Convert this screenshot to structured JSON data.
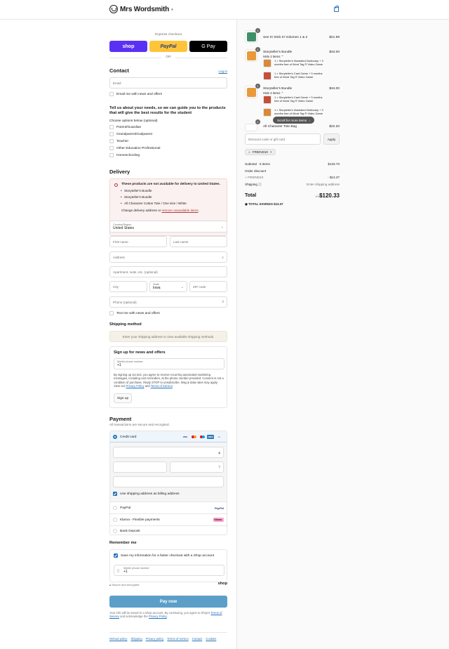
{
  "header": {
    "brand": "Mrs Wordsmith",
    "brand_suffix": "®"
  },
  "express": {
    "label": "Express checkout",
    "shop": "shop",
    "paypal": "PayPal",
    "gpay": "G Pay",
    "or": "OR"
  },
  "contact": {
    "title": "Contact",
    "login": "Log in",
    "email_placeholder": "Email",
    "email_news": "Email me with news and offers",
    "question": "Tell us about your needs, so we can guide you to the products that will give the best results for the student",
    "options_label": "Choose options below (optional)",
    "options": [
      "Parent/Guardian",
      "Grandparent/Godparent",
      "Teacher",
      "Other Education Professional",
      "Homeschooling"
    ]
  },
  "delivery": {
    "title": "Delivery",
    "alert_title": "These products are not available for delivery to United States.",
    "alert_items": [
      "Storyteller's Bundle",
      "Storyteller's Bundle",
      "All Character Cotton Tote / One size / White"
    ],
    "alert_change": "Change delivery address or",
    "alert_link": "remove unavailable items",
    "alert_end": ".",
    "country_label": "Country/Region",
    "country_value": "United States",
    "first_name": "First name",
    "last_name": "Last name",
    "address": "Address",
    "apartment": "Apartment, suite, etc. (optional)",
    "city": "City",
    "state_label": "State",
    "state_value": "Iowa",
    "zip": "ZIP code",
    "phone": "Phone (optional)",
    "text_news": "Text me with news and offers"
  },
  "shipping": {
    "title": "Shipping method",
    "notice": "Enter your shipping address to view available shipping methods."
  },
  "signup": {
    "title": "Sign up for news and offers",
    "phone_label": "Mobile phone number",
    "phone_value": "+1",
    "fine": "By signing up via text, you agree to receive recurring automated marketing messages, including cart reminders, at the phone number provided. Consent is not a condition of purchase. Reply STOP to unsubscribe. Msg & data rates may apply. View our",
    "privacy": "Privacy Policy",
    "and": "and",
    "terms": "Terms of Service",
    "end": ".",
    "button": "Sign up"
  },
  "payment": {
    "title": "Payment",
    "subtitle": "All transactions are secure and encrypted.",
    "credit_card": "Credit card",
    "card_brands": [
      "VISA",
      "MC",
      "MC",
      "AMEX",
      "+4"
    ],
    "use_shipping": "Use shipping address as billing address",
    "paypal": "PayPal",
    "paypal_logo": "PayPal",
    "klarna": "Klarna - Flexible payments",
    "klarna_logo": "Klarna.",
    "bank": "Bank Deposit"
  },
  "remember": {
    "title": "Remember me",
    "save": "Save my information for a faster checkout with a Shop account",
    "phone_label": "Mobile phone number",
    "phone_value": "+1",
    "secure": "Secure and encrypted",
    "shop": "shop"
  },
  "pay_button": "Pay now",
  "legal": {
    "text": "Your info will be saved to a Shop account. By continuing, you agree to Shop's",
    "terms": "Terms of Service",
    "mid": "and acknowledge the",
    "privacy": "Privacy Policy",
    "end": "."
  },
  "footer": [
    "Refund policy",
    "Shipping",
    "Privacy policy",
    "Terms of service",
    "Contact",
    "Cookies"
  ],
  "cart": {
    "items": [
      {
        "qty": "1",
        "name": "See It! Stick It! Volumes 1 & 2",
        "price": "$21.99"
      },
      {
        "qty": "1",
        "name": "Storyteller's Bundle",
        "price": "$34.00",
        "hide": "Hide 2 items",
        "sub": [
          "1 × Storyteller's Illustrated Dictionary + 3 months free of Word Tag ® Video Game",
          "1 × Storyteller's Card Game + 3 months free of Word Tag ® Video Game"
        ]
      },
      {
        "qty": "1",
        "name": "Storyteller's Bundle",
        "price": "$34.00",
        "hide": "Hide 2 items",
        "sub": [
          "1 × Storyteller's Card Game + 3 months free of Word Tag ® Video Game",
          "1 × Storyteller's Illustrated Dictionary + 3 months free of Word Tag ® Video Game"
        ]
      },
      {
        "qty": "1",
        "name": "All Character Tote Bag",
        "price": "$22.20"
      }
    ],
    "scroll_pill": "Scroll for more items",
    "discount_placeholder": "Discount code or gift card",
    "apply": "Apply",
    "code": "FRIEND10",
    "subtotal_label": "Subtotal · 5 items",
    "subtotal": "$133.70",
    "order_discount": "Order discount",
    "discount_code": "FRIEND10",
    "discount_value": "- $13.37",
    "shipping_label": "Shipping",
    "shipping_value": "Enter shipping address",
    "total_label": "Total",
    "currency": "USD",
    "total": "$120.33",
    "savings_label": "TOTAL SAVINGS",
    "savings": "$13.37"
  }
}
